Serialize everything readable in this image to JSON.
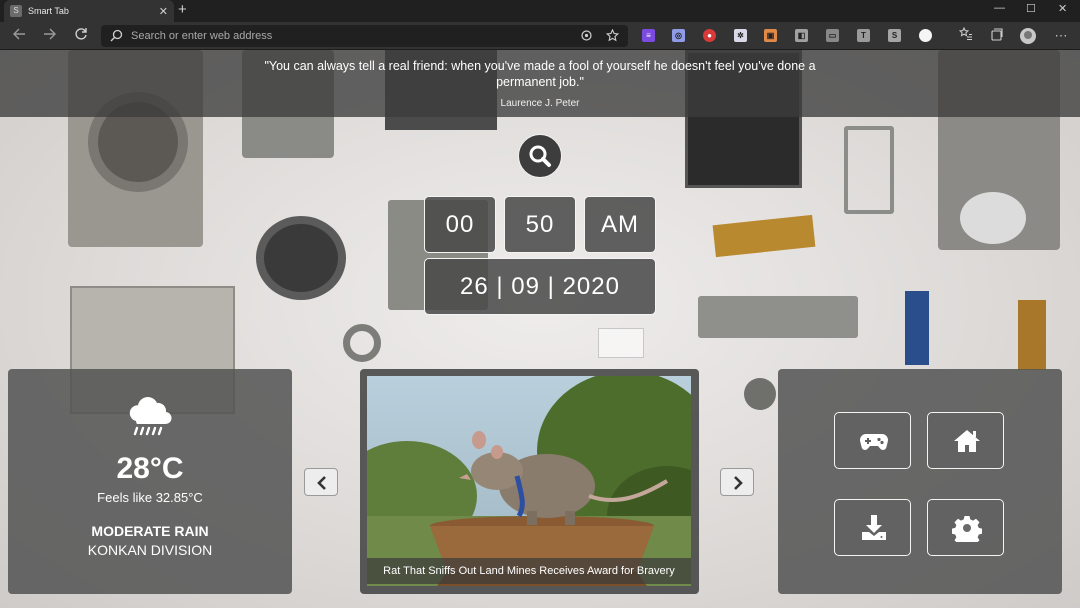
{
  "browser": {
    "tab_title": "Smart Tab",
    "tab_favicon_letter": "S",
    "close_tab_glyph": "✕",
    "new_tab_glyph": "+",
    "window_controls": [
      "—",
      "☐",
      "✕"
    ],
    "address_placeholder": "Search or enter web address",
    "extensions": [
      "≡",
      "◎",
      "●",
      "✲",
      "▣",
      "◧",
      "▭",
      "T",
      "S",
      "●"
    ]
  },
  "quote": {
    "text": "\"You can always tell a real friend: when you've made a fool of yourself he doesn't feel you've done a permanent job.\"",
    "author": "Laurence J. Peter"
  },
  "clock": {
    "hours": "00",
    "minutes": "50",
    "period": "AM",
    "date": "26 | 09 | 2020"
  },
  "weather": {
    "icon": "rain-cloud-icon",
    "temperature": "28°C",
    "feels_like": "Feels like 32.85°C",
    "condition": "MODERATE RAIN",
    "location": "KONKAN DIVISION"
  },
  "news": {
    "caption": "Rat That Sniffs Out Land Mines Receives Award for Bravery"
  },
  "shortcuts": [
    "gamepad-icon",
    "home-icon",
    "download-icon",
    "gear-icon"
  ],
  "colors": {
    "panel": "#545454",
    "chrome_dark": "#202020",
    "chrome_toolbar": "#333333",
    "text": "#ffffff"
  }
}
